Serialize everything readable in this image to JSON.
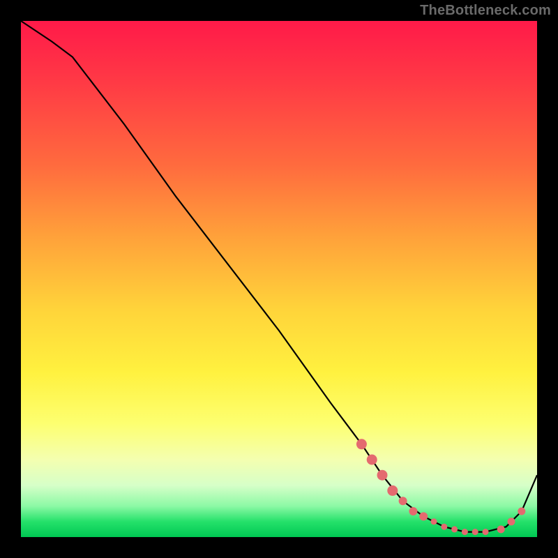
{
  "watermark": "TheBottleneck.com",
  "chart_data": {
    "type": "line",
    "title": "",
    "xlabel": "",
    "ylabel": "",
    "xlim": [
      0,
      100
    ],
    "ylim": [
      0,
      100
    ],
    "grid": false,
    "series": [
      {
        "name": "bottleneck-curve",
        "x": [
          0,
          6,
          10,
          20,
          30,
          40,
          50,
          60,
          66,
          70,
          74,
          78,
          82,
          86,
          90,
          94,
          97,
          100
        ],
        "y": [
          100,
          96,
          93,
          80,
          66,
          53,
          40,
          26,
          18,
          12,
          7,
          4,
          2,
          1,
          1,
          2,
          5,
          12
        ],
        "color": "#000000"
      }
    ],
    "markers": [
      {
        "name": "highlight-dots",
        "x": [
          66,
          68,
          70,
          72,
          74,
          76,
          78,
          80,
          82,
          84,
          86,
          88,
          90,
          93,
          95,
          97
        ],
        "y": [
          18,
          15,
          12,
          9,
          7,
          5,
          4,
          3,
          2,
          1.5,
          1,
          1,
          1,
          1.5,
          3,
          5
        ],
        "color": "#e46a6f",
        "size_profile": "big-then-small"
      }
    ],
    "colors": {
      "gradient_top": "#ff1a49",
      "gradient_mid": "#fff13f",
      "gradient_bottom": "#00c853",
      "frame": "#000000",
      "marker": "#e46a6f"
    }
  }
}
